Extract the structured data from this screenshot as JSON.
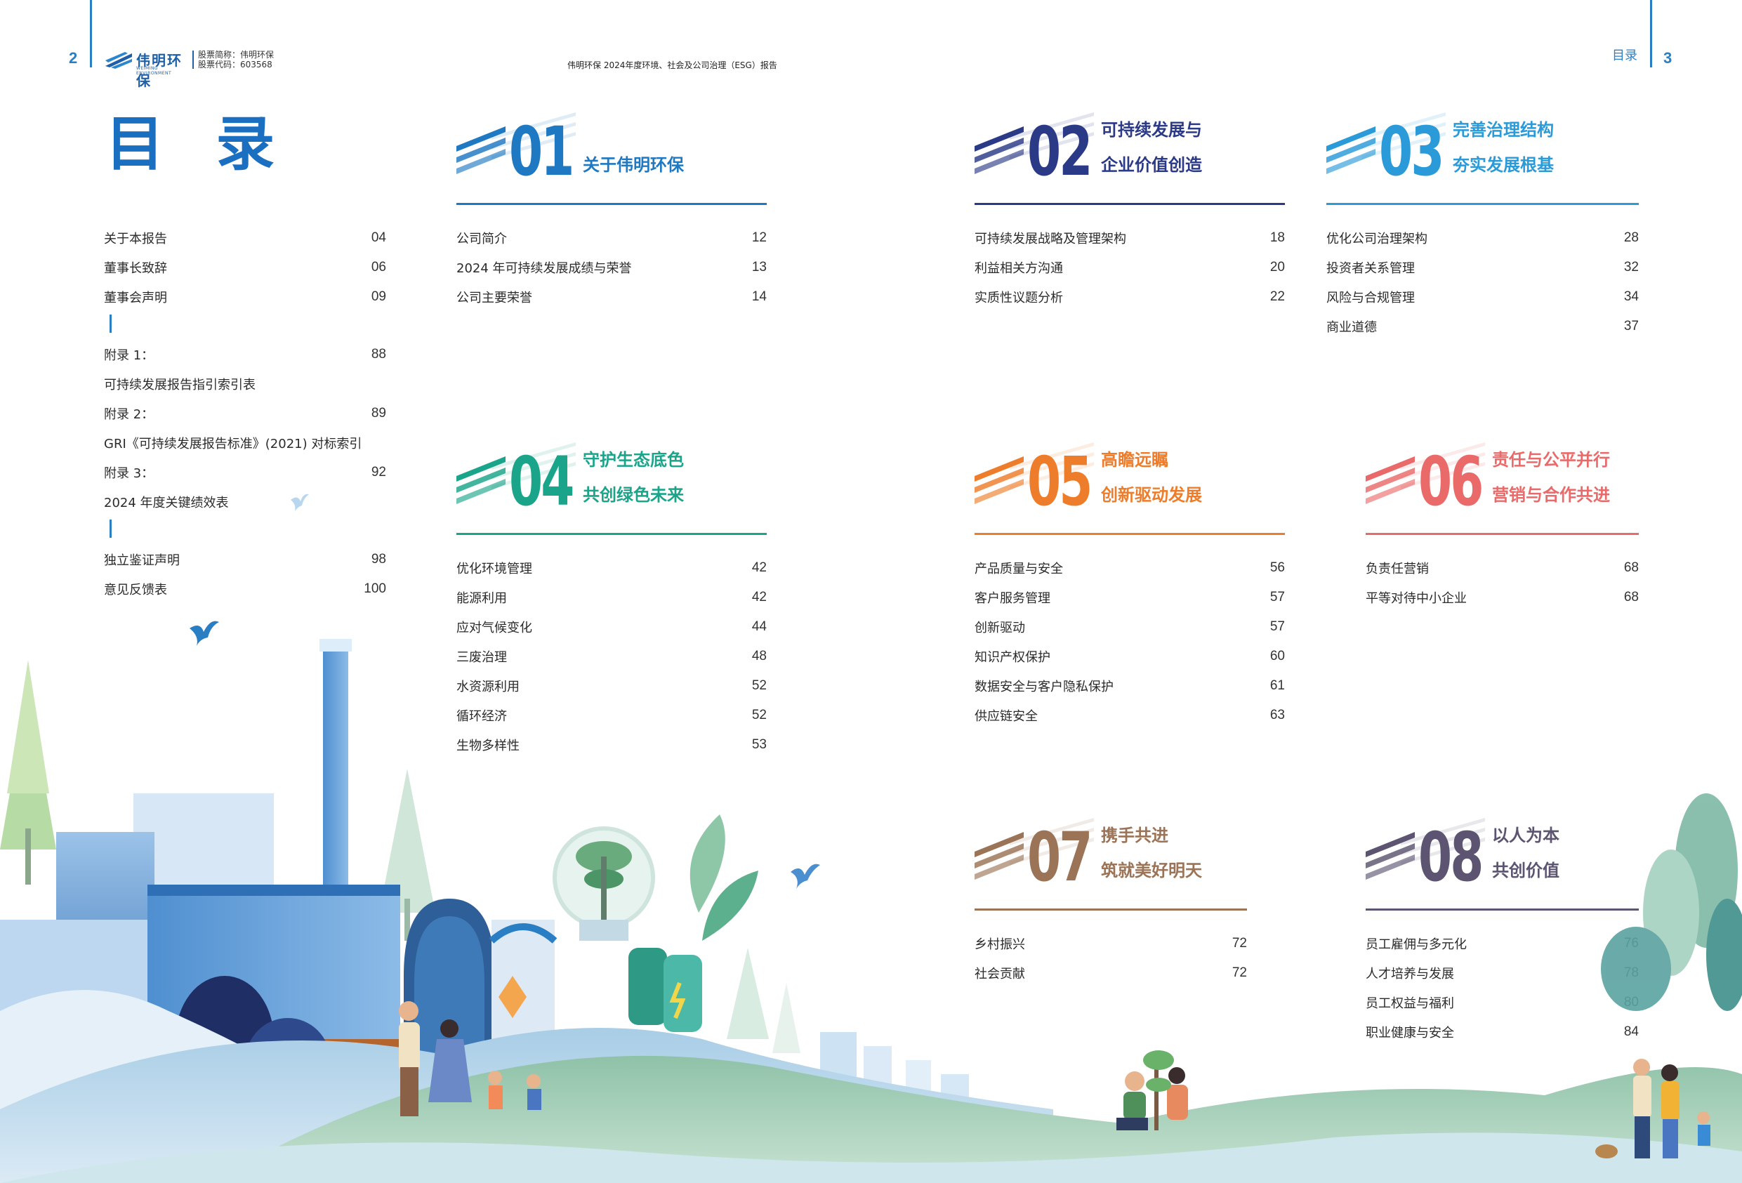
{
  "header": {
    "page_left": "2",
    "page_right": "3",
    "logo_cn": "伟明环保",
    "logo_en": "WEIMING ENVIRONMENT",
    "stock_name": "股票简称：伟明环保",
    "stock_code": "股票代码：603568",
    "report_title": "伟明环保 2024年度环境、社会及公司治理（ESG）报告",
    "toc_label_right": "目录"
  },
  "toc_heading": "目 录",
  "left": {
    "items": [
      {
        "label": "关于本报告",
        "page": "04"
      },
      {
        "label": "董事长致辞",
        "page": "06"
      },
      {
        "label": "董事会声明",
        "page": "09"
      },
      {
        "label": "附录 1：",
        "page": "88"
      },
      {
        "label": "可持续发展报告指引索引表",
        "page": ""
      },
      {
        "label": "附录 2：",
        "page": "89"
      },
      {
        "label": "GRI《可持续发展报告标准》(2021) 对标索引",
        "page": ""
      },
      {
        "label": "附录 3：",
        "page": "92"
      },
      {
        "label": "2024 年度关键绩效表",
        "page": ""
      },
      {
        "label": "独立鉴证声明",
        "page": "98"
      },
      {
        "label": "意见反馈表",
        "page": "100"
      }
    ]
  },
  "sections": [
    {
      "num": "01",
      "title1": "",
      "title2": "关于伟明环保",
      "color": "#1e78c2",
      "items": [
        {
          "label": "公司简介",
          "page": "12"
        },
        {
          "label": "2024 年可持续发展成绩与荣誉",
          "page": "13"
        },
        {
          "label": "公司主要荣誉",
          "page": "14"
        }
      ]
    },
    {
      "num": "02",
      "title1": "可持续发展与",
      "title2": "企业价值创造",
      "color": "#2b3a86",
      "items": [
        {
          "label": "可持续发展战略及管理架构",
          "page": "18"
        },
        {
          "label": "利益相关方沟通",
          "page": "20"
        },
        {
          "label": "实质性议题分析",
          "page": "22"
        }
      ]
    },
    {
      "num": "03",
      "title1": "完善治理结构",
      "title2": "夯实发展根基",
      "color": "#2a9ad8",
      "items": [
        {
          "label": "优化公司治理架构",
          "page": "28"
        },
        {
          "label": "投资者关系管理",
          "page": "32"
        },
        {
          "label": "风险与合规管理",
          "page": "34"
        },
        {
          "label": "商业道德",
          "page": "37"
        }
      ]
    },
    {
      "num": "04",
      "title1": "守护生态底色",
      "title2": "共创绿色未来",
      "color": "#1aa58a",
      "items": [
        {
          "label": "优化环境管理",
          "page": "42"
        },
        {
          "label": "能源利用",
          "page": "42"
        },
        {
          "label": "应对气候变化",
          "page": "44"
        },
        {
          "label": "三废治理",
          "page": "48"
        },
        {
          "label": "水资源利用",
          "page": "52"
        },
        {
          "label": "循环经济",
          "page": "52"
        },
        {
          "label": "生物多样性",
          "page": "53"
        }
      ]
    },
    {
      "num": "05",
      "title1": "高瞻远瞩",
      "title2": "创新驱动发展",
      "color": "#ee7d2b",
      "items": [
        {
          "label": "产品质量与安全",
          "page": "56"
        },
        {
          "label": "客户服务管理",
          "page": "57"
        },
        {
          "label": "创新驱动",
          "page": "57"
        },
        {
          "label": "知识产权保护",
          "page": "60"
        },
        {
          "label": "数据安全与客户隐私保护",
          "page": "61"
        },
        {
          "label": "供应链安全",
          "page": "63"
        }
      ]
    },
    {
      "num": "06",
      "title1": "责任与公平并行",
      "title2": "营销与合作共进",
      "color": "#ea6a6a",
      "items": [
        {
          "label": "负责任营销",
          "page": "68"
        },
        {
          "label": "平等对待中小企业",
          "page": "68"
        }
      ]
    },
    {
      "num": "07",
      "title1": "携手共进",
      "title2": "筑就美好明天",
      "color": "#9b7356",
      "items": [
        {
          "label": "乡村振兴",
          "page": "72"
        },
        {
          "label": "社会贡献",
          "page": "72"
        }
      ]
    },
    {
      "num": "08",
      "title1": "以人为本",
      "title2": "共创价值",
      "color": "#5c5470",
      "items": [
        {
          "label": "员工雇佣与多元化",
          "page": "76"
        },
        {
          "label": "人才培养与发展",
          "page": "78"
        },
        {
          "label": "员工权益与福利",
          "page": "80"
        },
        {
          "label": "职业健康与安全",
          "page": "84"
        }
      ]
    }
  ],
  "colors": {
    "brand_blue": "#1a6fc0",
    "accent_blue": "#2a7fc4"
  }
}
